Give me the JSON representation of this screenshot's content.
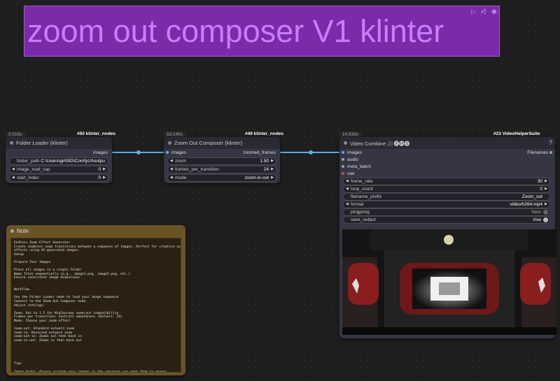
{
  "title_node": {
    "text": "zoom out composer V1 klinter",
    "icons": [
      "play-icon",
      "mute-icon",
      "eye-icon"
    ]
  },
  "nodes": {
    "folder_loader": {
      "time": "0.515s",
      "id": "#50 klinter_nodes",
      "title": "Folder Loader (klinter)",
      "output": "images",
      "folder_path": {
        "label": "folder_path",
        "value": "C:\\Users\\girl\\SD\\ComfyUI\\outpu"
      },
      "image_load_cap": {
        "label": "image_load_cap",
        "value": "0"
      },
      "start_index": {
        "label": "start_index",
        "value": "0"
      }
    },
    "zoom_composer": {
      "time": "53.145s",
      "id": "#49 klinter_nodes",
      "title": "Zoom Out Composer (klinter)",
      "input": "images",
      "output": "zoomed_frames",
      "zoom": {
        "label": "zoom",
        "value": "1.50"
      },
      "frames_per_transition": {
        "label": "frames_per_transition",
        "value": "24"
      },
      "mode": {
        "label": "mode",
        "value": "zoom-in-out"
      }
    },
    "video_combine": {
      "time": "14.936s",
      "id": "#23 VideoHelperSuite",
      "title": "Video Combine",
      "title_icons": "🎥🅥🅗🅢",
      "inputs": [
        "images",
        "audio",
        "meta_batch",
        "vae"
      ],
      "output": "Filenames",
      "help": "?",
      "frame_rate": {
        "label": "frame_rate",
        "value": "30"
      },
      "loop_count": {
        "label": "loop_count",
        "value": "0"
      },
      "filename_prefix": {
        "label": "filename_prefix",
        "value": "Zoom_out"
      },
      "format": {
        "label": "format",
        "value": "video/h264-mp4"
      },
      "pingpong": {
        "label": "pingpong",
        "value": "false"
      },
      "save_output": {
        "label": "save_output",
        "value": "true"
      }
    }
  },
  "note": {
    "title": "Note",
    "lines": [
      "Endless Zoom Effect Generator",
      "Create seamless zoom transitions between a sequence of images. Perfect for creative zoom",
      "effects using AI-generated images.",
      "Setup",
      "",
      "Prepare Your Images",
      "",
      "Place all images in a single folder",
      "Name files sequentially (e.g., image1.png, image2.png, etc.)",
      "Ensure consistent image dimensions",
      "",
      "",
      "Workflow",
      "",
      "Use the Folder Loader node to load your image sequence",
      "Connect to the Zoom Out Composer node",
      "Adjust settings:",
      "",
      "Zoom: Set to 1.5 for MidJourney zoom-out compatibility",
      "Frames per transition: Controls smoothness (default: 24)",
      "Mode: Choose your zoom effect",
      "",
      "zoom-out: Standard outward zoom",
      "zoom-in: Reversed outward zoom",
      "zoom-out-in: Zooms out then back in",
      "zoom-in-out: Zooms in then back out",
      "",
      "",
      "",
      "",
      "",
      "Tips",
      "",
      "Image Order: Always arrange your images in the sequence you want them to appear"
    ]
  },
  "colors": {
    "title_bg": "#7b2aa8",
    "title_text": "#c77dff",
    "link": "#5ab0e8",
    "note_bg": "#6a5426",
    "node_bg": "#353543"
  }
}
